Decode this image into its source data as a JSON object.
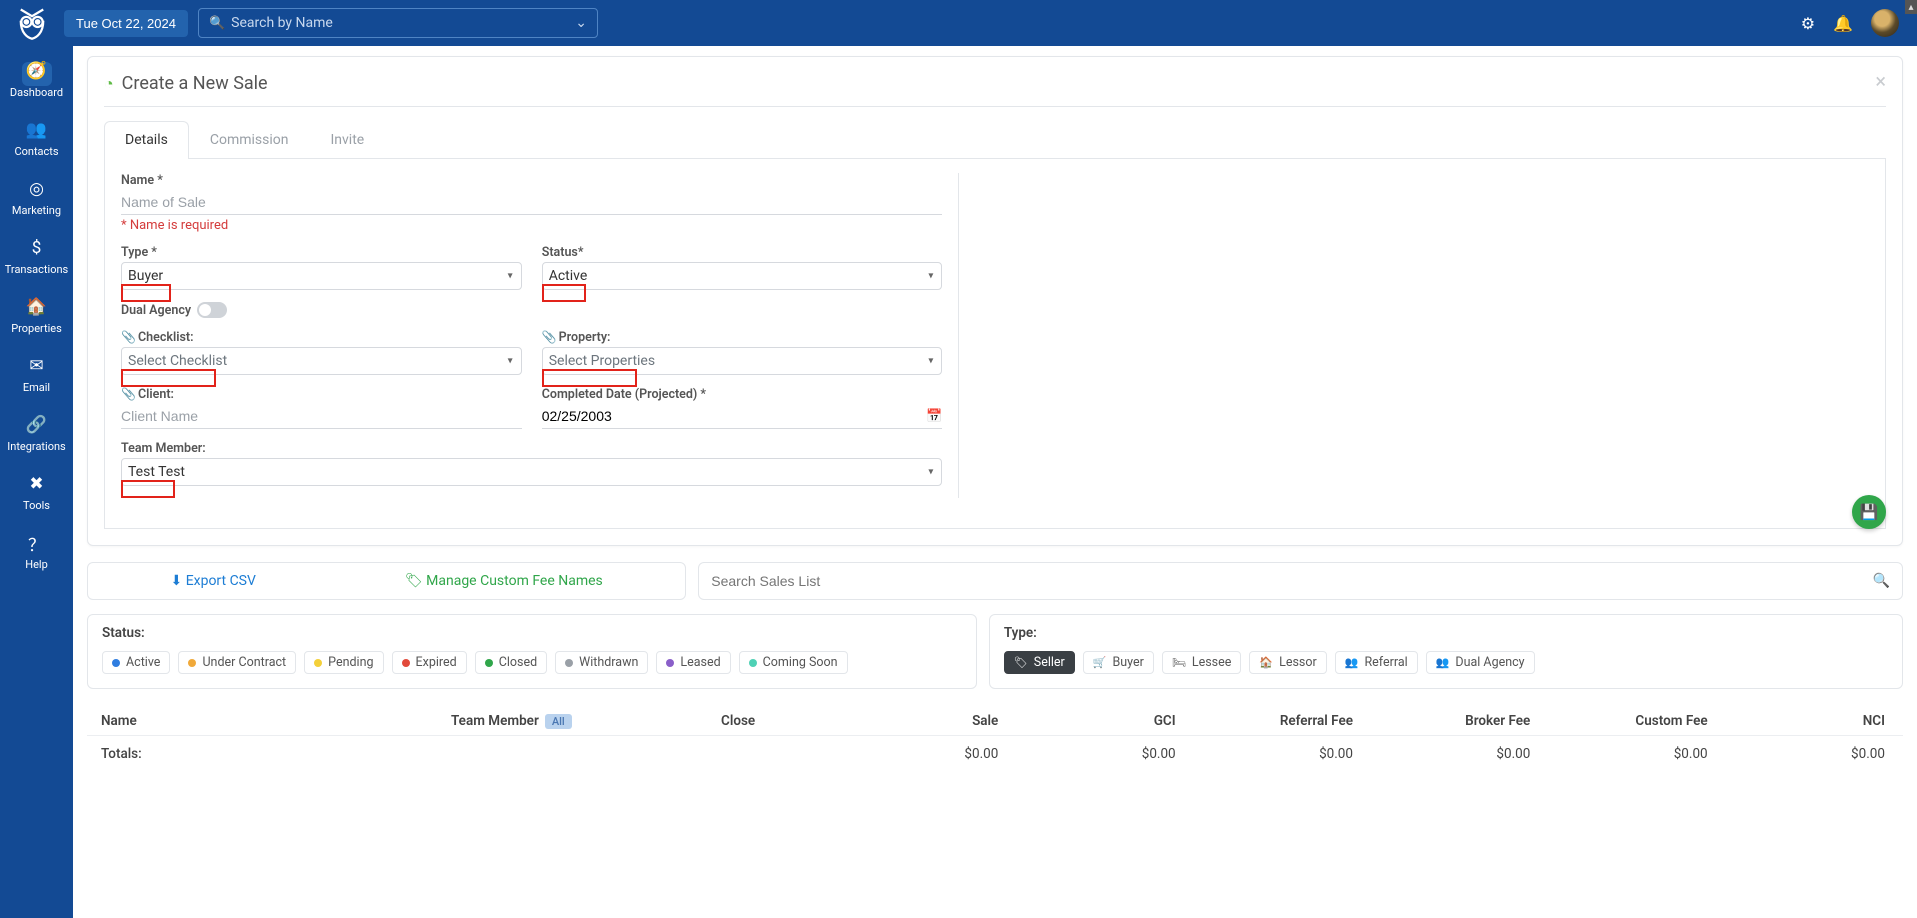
{
  "header": {
    "date": "Tue Oct 22, 2024",
    "search_placeholder": "Search by Name"
  },
  "sidebar": {
    "items": [
      {
        "label": "Dashboard"
      },
      {
        "label": "Contacts"
      },
      {
        "label": "Marketing"
      },
      {
        "label": "Transactions"
      },
      {
        "label": "Properties"
      },
      {
        "label": "Email"
      },
      {
        "label": "Integrations"
      },
      {
        "label": "Tools"
      },
      {
        "label": "Help"
      }
    ]
  },
  "modal": {
    "title": "Create a New Sale",
    "tabs": [
      "Details",
      "Commission",
      "Invite"
    ],
    "labels": {
      "name": "Name *",
      "name_ph": "Name of Sale",
      "name_err": "* Name is required",
      "type": "Type *",
      "type_val": "Buyer",
      "status": "Status*",
      "status_val": "Active",
      "dual": "Dual Agency",
      "checklist": "Checklist:",
      "checklist_ph": "Select Checklist",
      "property": "Property:",
      "property_ph": "Select Properties",
      "client": "Client:",
      "client_ph": "Client Name",
      "compdate": "Completed Date (Projected) *",
      "compdate_val": "02/25/2003",
      "team": "Team Member:",
      "team_val": "Test Test"
    }
  },
  "toolbar": {
    "export": "Export CSV",
    "manage": "Manage Custom Fee Names",
    "search_ph": "Search Sales List"
  },
  "filters": {
    "status_title": "Status:",
    "statuses": [
      {
        "label": "Active",
        "color": "#2f7de0"
      },
      {
        "label": "Under Contract",
        "color": "#f0a93a"
      },
      {
        "label": "Pending",
        "color": "#f4d03a"
      },
      {
        "label": "Expired",
        "color": "#e24a3b"
      },
      {
        "label": "Closed",
        "color": "#30a64a"
      },
      {
        "label": "Withdrawn",
        "color": "#9aa0a7"
      },
      {
        "label": "Leased",
        "color": "#8a5fc9"
      },
      {
        "label": "Coming Soon",
        "color": "#4fd1b5"
      }
    ],
    "type_title": "Type:",
    "types": [
      {
        "label": "Seller"
      },
      {
        "label": "Buyer"
      },
      {
        "label": "Lessee"
      },
      {
        "label": "Lessor"
      },
      {
        "label": "Referral"
      },
      {
        "label": "Dual Agency"
      }
    ]
  },
  "table": {
    "headers": {
      "name": "Name",
      "team": "Team Member",
      "all": "All",
      "close": "Close",
      "sale": "Sale",
      "gci": "GCI",
      "referral": "Referral Fee",
      "broker": "Broker Fee",
      "custom": "Custom Fee",
      "nci": "NCI"
    },
    "totals": {
      "label": "Totals:",
      "sale": "$0.00",
      "gci": "$0.00",
      "referral": "$0.00",
      "broker": "$0.00",
      "custom": "$0.00",
      "nci": "$0.00"
    }
  }
}
